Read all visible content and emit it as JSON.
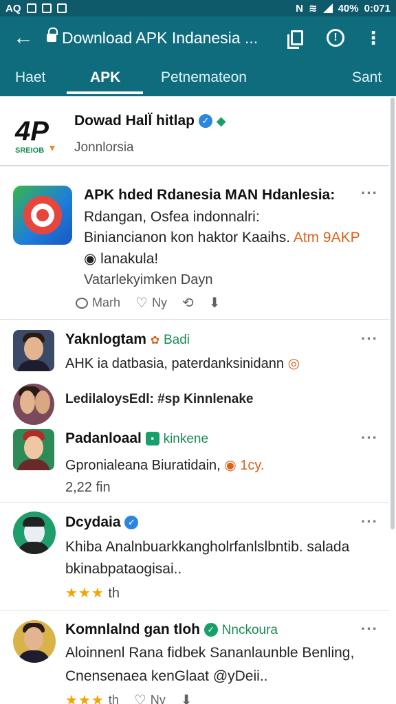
{
  "status_bar": {
    "left": "AQ",
    "battery": "40%",
    "time": "0:071",
    "signal_text": "N"
  },
  "app_bar": {
    "title": "Download APK Indanesia ...",
    "back_icon": "arrow-left-icon",
    "copy_icon": "copy-icon",
    "info_icon": "info-icon",
    "more_icon": "more-vert-icon"
  },
  "tabs": [
    {
      "label": "Haet"
    },
    {
      "label": "APK",
      "active": true
    },
    {
      "label": "Petnemateon"
    },
    {
      "label": "Sant"
    }
  ],
  "profile": {
    "logo_text": "4P",
    "logo_sub": "SREIOB",
    "name": "Dowad Hall̈ hitlap",
    "subtitle": "Jonnlorsia"
  },
  "posts": [
    {
      "title": "APK hded Rdanesia MAN Hdanlesia:",
      "line1": "Rdangan, Osfea indonnalri:",
      "line2": "Biniancianon kon haktor Kaaihs.",
      "line2_accent": "Atm 9AKP",
      "line3": "lanakula!",
      "line4": "Vatarlekyimken Dayn",
      "action_comment": "Marh",
      "action_like": "Ny"
    },
    {
      "name": "Yaknlogtam",
      "tag": "Badi",
      "text": "AHK ia datbasia, paterdanksinidann"
    },
    {
      "text": "LedilaloysEdl: #sp Kinnlenake"
    },
    {
      "name": "Padanloaal",
      "tag": "kinkene",
      "text": "Gpronialeana Biuratidain,",
      "tag2": "1cy.",
      "meta": "2,22 fin"
    },
    {
      "name": "Dcydaia",
      "text1": "Khiba Analnbuarkkangholrfanlslbntib. salada",
      "text2": "bkinabpataogisai..",
      "rating": "★★★",
      "rating_text": "th"
    },
    {
      "name": "Komnlalnd gan tloh",
      "tag": "Nnckoura",
      "text1": "Aloinnenl Rana fidbek Sananlaunble Benling,",
      "text2": "Cnensenaea kenGlaat @yDeii..",
      "rating": "★★★",
      "rating_text": "th",
      "action_like": "Ny"
    }
  ],
  "colors": {
    "primary": "#0f6c7d",
    "status": "#0e5a6b",
    "verified_blue": "#2a86e0",
    "green": "#1a8a55",
    "orange": "#d9621b"
  }
}
